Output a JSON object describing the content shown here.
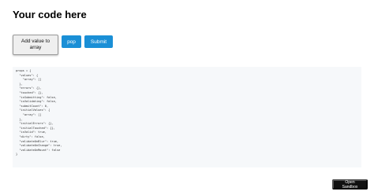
{
  "page": {
    "title": "Your code here"
  },
  "buttons": {
    "add_value_label": "Add value to array",
    "pop_label": "pop",
    "submit_label": "Submit"
  },
  "code": {
    "lines": [
      "props = {",
      "  \"values\": {",
      "    \"array\": []",
      "  },",
      "  \"errors\": {},",
      "  \"touched\": {},",
      "  \"isSubmitting\": false,",
      "  \"isValidating\": false,",
      "  \"submitCount\": 0,",
      "  \"initialValues\": {",
      "    \"array\": []",
      "  },",
      "  \"initialErrors\": {},",
      "  \"initialTouched\": {},",
      "  \"isValid\": true,",
      "  \"dirty\": false,",
      "  \"validateOnBlur\": true,",
      "  \"validateOnChange\": true,",
      "  \"validateOnMount\": false",
      "}"
    ]
  },
  "footer": {
    "open_sandbox_label": "Open Sandbox"
  }
}
